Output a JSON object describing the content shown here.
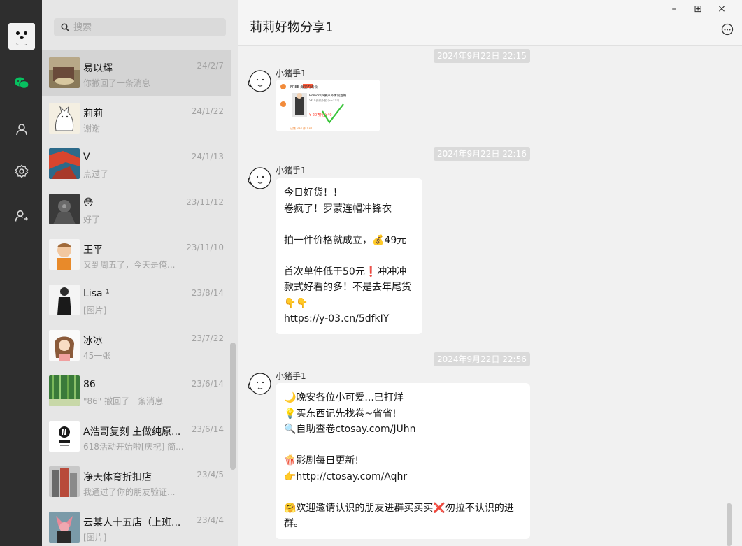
{
  "search": {
    "placeholder": "搜索"
  },
  "rail": {
    "icons": [
      "chat-icon",
      "contacts-icon",
      "settings-icon",
      "friend-request-icon"
    ]
  },
  "conversations": [
    {
      "name": "易以辉",
      "date": "24/2/7",
      "preview": "你撤回了一条消息",
      "active": true
    },
    {
      "name": "莉莉",
      "date": "24/1/22",
      "preview": "谢谢"
    },
    {
      "name": "V",
      "date": "24/1/13",
      "preview": "点过了"
    },
    {
      "name": "😳",
      "date": "23/11/12",
      "preview": "好了"
    },
    {
      "name": "王平",
      "date": "23/11/10",
      "preview": "又到周五了，今天是俺..."
    },
    {
      "name": "Lisa ¹",
      "date": "23/8/14",
      "preview": "[图片]"
    },
    {
      "name": "冰冰",
      "date": "23/7/22",
      "preview": "45一张"
    },
    {
      "name": "86",
      "date": "23/6/14",
      "preview": "\"86\" 撤回了一条消息"
    },
    {
      "name": "A浩哥复刻 主做纯原...",
      "date": "23/6/14",
      "preview": "618活动开始啦[庆祝] 简..."
    },
    {
      "name": "净天体育折扣店",
      "date": "23/4/5",
      "preview": "我通过了你的朋友验证..."
    },
    {
      "name": "云某人十五店（上班...",
      "date": "23/4/4",
      "preview": "[图片]"
    }
  ],
  "chat": {
    "title": "莉莉好物分享1",
    "window_buttons": {
      "minimize": "–",
      "maximize": "⊞",
      "close": "×"
    },
    "messages": [
      {
        "timestamp": "2024年9月22日 22:15",
        "sender": "小猪手1",
        "type": "image",
        "image": {
          "header": "FREE 海宝内购会 ·",
          "product": "Romon/罗蒙户外休闲连帽",
          "detail": "SKU 长款外套  (S~XXL)",
          "price_old": "¥ 207",
          "price_new": "券后¥49",
          "footer": "已售 384 件 130"
        }
      },
      {
        "timestamp": "2024年9月22日 22:16",
        "sender": "小猪手1",
        "type": "text",
        "lines": [
          "今日好货！！",
          "卷疯了！罗蒙连帽冲锋衣",
          "",
          "拍一件价格就成立，💰49元",
          "",
          "首次单件低于50元❗冲冲冲",
          "款式好看的多！不是去年尾货",
          "👇👇",
          "https://y-03.cn/5dfkIY"
        ]
      },
      {
        "timestamp": "2024年9月22日 22:56",
        "sender": "小猪手1",
        "type": "text",
        "lines": [
          "🌙晚安各位小可爱...已打烊",
          "💡买东西记先找卷~省省!",
          "🔍自助查卷ctosay.com/JUhn",
          "",
          "🍿影剧每日更新!",
          "👉http://ctosay.com/Aqhr",
          "",
          "🤗欢迎邀请认识的朋友进群买买买❌勿拉不认识的进",
          "群。"
        ]
      }
    ]
  },
  "colors": {
    "rail": "#2e2e2e",
    "list_bg": "#e6e6e6",
    "active_row": "#d4d4d4",
    "chat_bg": "#f1f1f1",
    "wechat_green": "#07c160",
    "timestamp_bg": "#dadada"
  }
}
